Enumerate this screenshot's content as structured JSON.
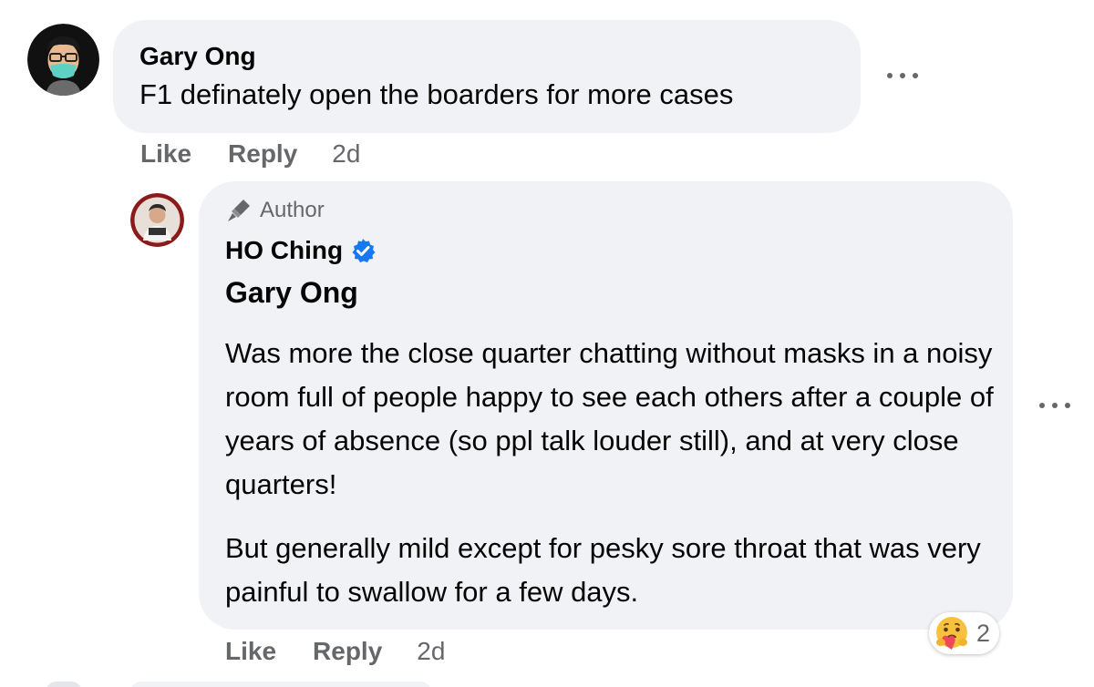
{
  "comment": {
    "author": "Gary Ong",
    "text": "F1 definately open the boarders for more cases",
    "actions": {
      "like": "Like",
      "reply": "Reply",
      "time": "2d"
    }
  },
  "reply": {
    "badge": "Author",
    "author": "HO Ching",
    "verified": true,
    "mention": "Gary Ong",
    "paragraphs": [
      "Was more the close quarter chatting without masks in a noisy room full of people happy to see each others after a couple of years of absence (so ppl talk louder still), and at very close quarters!",
      "But generally mild except for pesky sore throat that was very painful to swallow for a few days."
    ],
    "reaction": {
      "icon": "care-emoji",
      "count": "2"
    },
    "actions": {
      "like": "Like",
      "reply": "Reply",
      "time": "2d"
    }
  },
  "colors": {
    "bubble": "#f0f2f5",
    "secondary_text": "#65676b",
    "verified_blue": "#1877f2"
  }
}
